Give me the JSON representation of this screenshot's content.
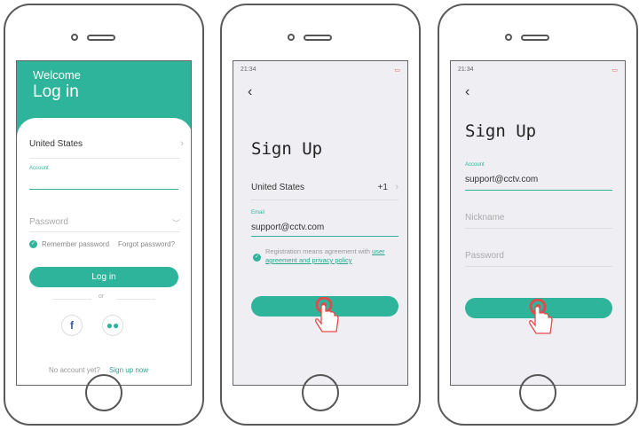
{
  "phone1": {
    "welcome": "Welcome",
    "title": "Log in",
    "country": "United States",
    "account_label": "Account",
    "password_placeholder": "Password",
    "remember": "Remember password",
    "forgot": "Forgot password?",
    "login_button": "Log in",
    "or": "or",
    "no_account": "No account yet?",
    "sign_up_now": "Sign up now"
  },
  "phone2": {
    "status_time": "21:34",
    "title": "Sign Up",
    "country": "United States",
    "country_code": "+1",
    "email_label": "Email",
    "email_value": "support@cctv.com",
    "agreement_pre": "Registration means agreement with",
    "agreement_link": "user agreement and privacy policy"
  },
  "phone3": {
    "status_time": "21:34",
    "title": "Sign Up",
    "account_label": "Account",
    "account_value": "support@cctv.com",
    "nickname_placeholder": "Nickname",
    "password_placeholder": "Password"
  },
  "colors": {
    "accent": "#2eb49b",
    "tap": "#e34a4a"
  },
  "icons": [
    "facebook-icon",
    "wechat-icon",
    "chevron-right-icon",
    "eye-closed-icon",
    "back-arrow-icon",
    "tap-hand-icon"
  ]
}
